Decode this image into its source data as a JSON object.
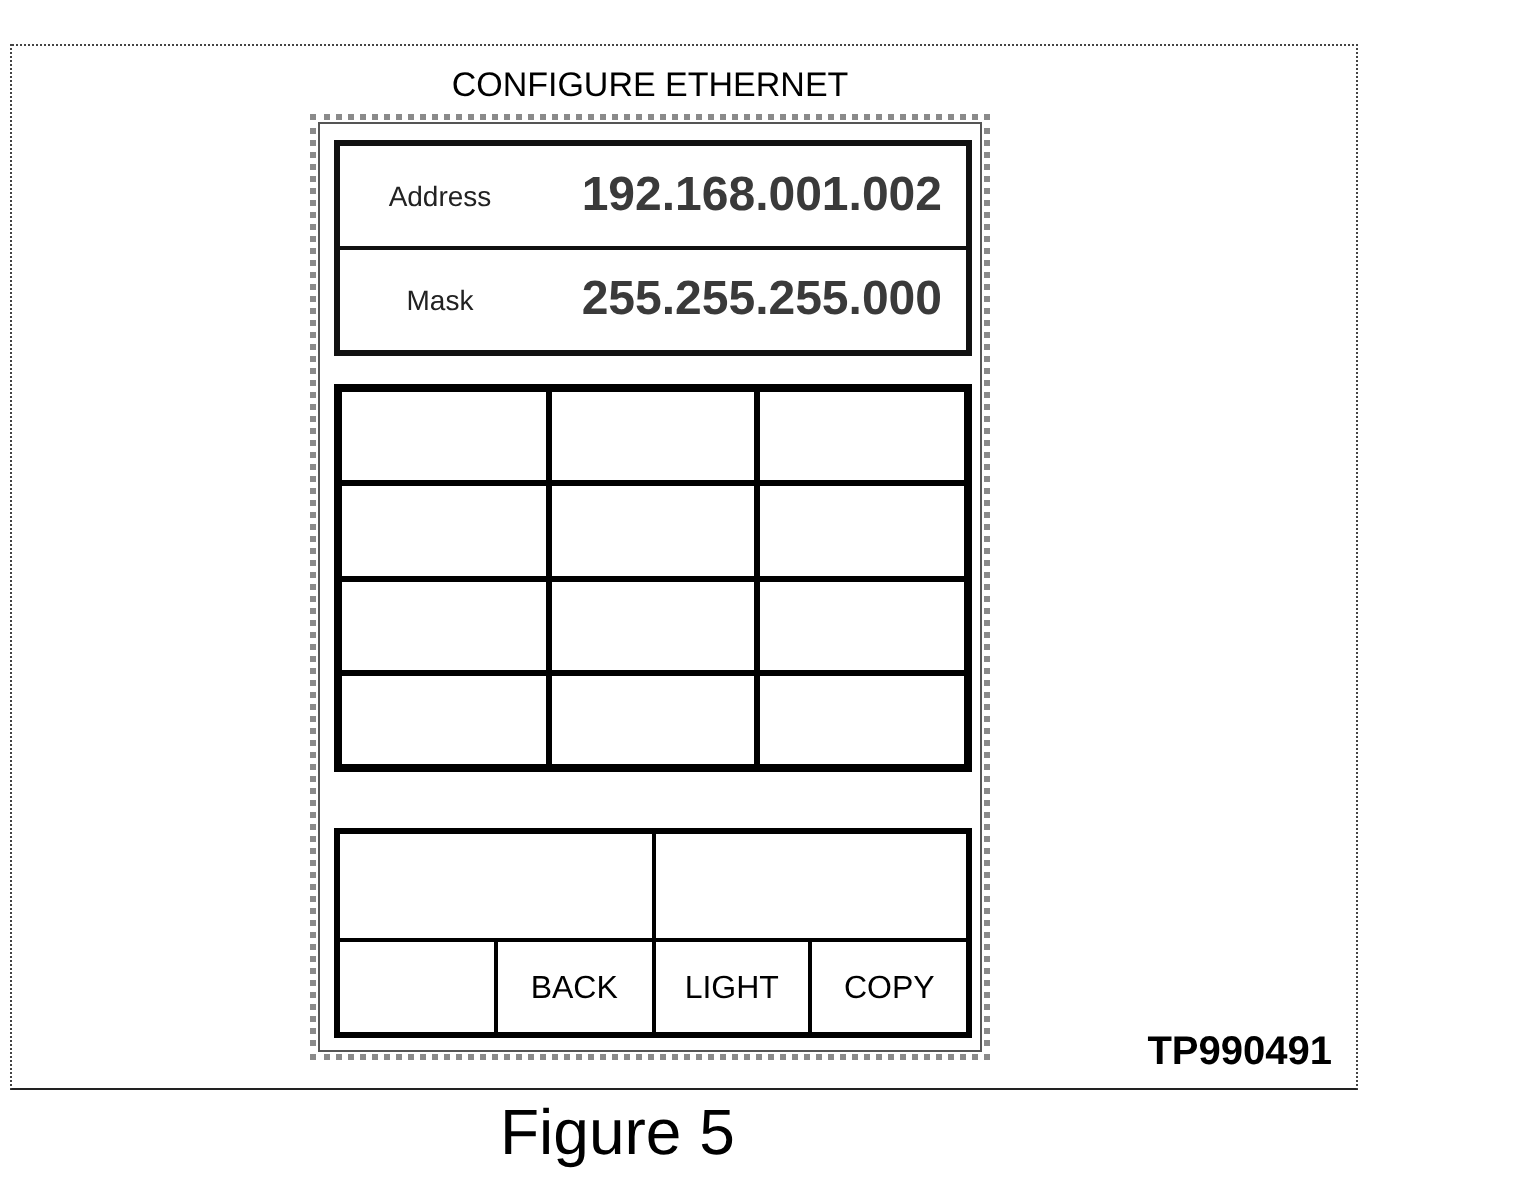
{
  "figure": {
    "title": "CONFIGURE ETHERNET",
    "display": [
      {
        "label": "Address",
        "value": "192.168.001.002"
      },
      {
        "label": "Mask",
        "value": "255.255.255.000"
      }
    ],
    "keypad": {
      "rows": [
        {
          "keys": [
            {
              "kind": "blank"
            },
            {
              "kind": "blank"
            },
            {
              "kind": "blank"
            }
          ]
        },
        {
          "keys": [
            {
              "kind": "blank"
            },
            {
              "kind": "blank"
            },
            {
              "kind": "blank"
            }
          ]
        },
        {
          "keys": [
            {
              "kind": "blank"
            },
            {
              "kind": "blank"
            },
            {
              "kind": "blank"
            }
          ]
        },
        {
          "keys": [
            {
              "kind": "blank"
            },
            {
              "kind": "blank"
            },
            {
              "kind": "blank"
            }
          ]
        }
      ]
    },
    "softkeys": {
      "rows": [
        {
          "keys": [
            {
              "kind": "blank"
            },
            {
              "kind": "blank"
            }
          ]
        },
        {
          "keys": [
            {
              "kind": "blank"
            },
            {
              "kind": "button",
              "label": "BACK"
            },
            {
              "kind": "button",
              "label": "LIGHT"
            },
            {
              "kind": "button",
              "label": "COPY"
            }
          ]
        }
      ]
    },
    "code": "TP990491"
  },
  "caption": "Figure 5"
}
